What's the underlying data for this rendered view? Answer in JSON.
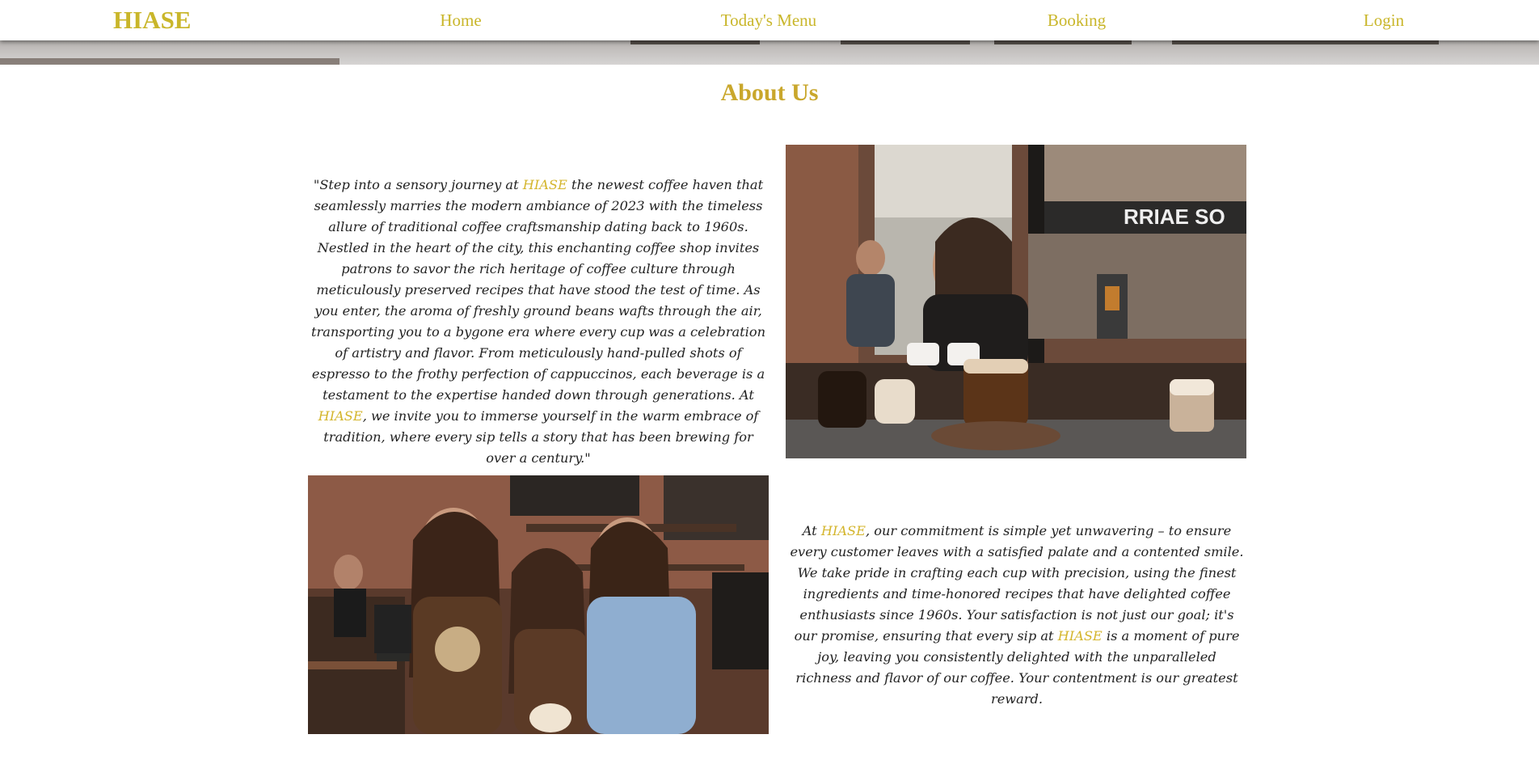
{
  "header": {
    "brand": "HIASE",
    "nav": [
      "Home",
      "Today's Menu",
      "Booking",
      "Login"
    ]
  },
  "about": {
    "title": "About Us",
    "paragraph1": {
      "p1": "\"Step into a sensory journey at ",
      "brand1": "HIASE",
      "p2": " the newest coffee haven that seamlessly marries the modern ambiance of 2023 with the timeless allure of traditional coffee craftsmanship dating back to 1960s. Nestled in the heart of the city, this enchanting coffee shop invites patrons to savor the rich heritage of coffee culture through meticulously preserved recipes that have stood the test of time. As you enter, the aroma of freshly ground beans wafts through the air, transporting you to a bygone era where every cup was a celebration of artistry and flavor. From meticulously hand-pulled shots of espresso to the frothy perfection of cappuccinos, each beverage is a testament to the expertise handed down through generations. At ",
      "brand2": "HIASE",
      "p3": ", we invite you to immerse yourself in the warm embrace of tradition, where every sip tells a story that has been brewing for over a century.\""
    },
    "paragraph2": {
      "p1": "At ",
      "brand1": "HIASE",
      "p2": ", our commitment is simple yet unwavering – to ensure every customer leaves with a satisfied palate and a contented smile. We take pride in crafting each cup with precision, using the finest ingredients and time-honored recipes that have delighted coffee enthusiasts since 1960s. Your satisfaction is not just our goal; it's our promise, ensuring that every sip at ",
      "brand2": "HIASE",
      "p3": " is a moment of pure joy, leaving you consistently delighted with the unparalleled richness and flavor of our coffee. Your contentment is our greatest reward."
    },
    "storefront_sign": "RRIAE SO"
  },
  "colors": {
    "accent": "#c9b62a",
    "title": "#c9a72c",
    "text": "#222222"
  }
}
